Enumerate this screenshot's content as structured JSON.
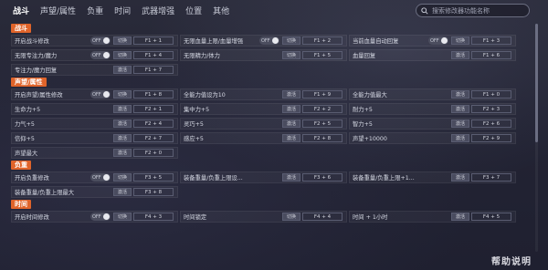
{
  "nav": {
    "tabs": [
      "战斗",
      "声望/属性",
      "负重",
      "时间",
      "武器增强",
      "位置",
      "其他"
    ],
    "active_index": 0
  },
  "search": {
    "placeholder": "搜索修改器功能名称"
  },
  "sections": [
    {
      "title": "战斗",
      "rows": [
        [
          {
            "label": "开启战斗修改",
            "type": "toggle",
            "toggle_text": "OFF",
            "action": "切换",
            "hotkey": "F1 + 1"
          },
          {
            "label": "无限血量上限/血量增强",
            "type": "toggle",
            "toggle_text": "OFF",
            "action": "切换",
            "hotkey": "F1 + 2"
          },
          {
            "label": "当前血量自动回复",
            "type": "toggle",
            "toggle_text": "OFF",
            "action": "切换",
            "hotkey": "F1 + 3"
          }
        ],
        [
          {
            "label": "无限专注力/魔力",
            "type": "toggle",
            "toggle_text": "OFF",
            "action": "切换",
            "hotkey": "F1 + 4"
          },
          {
            "label": "无限精力/体力",
            "type": "toggle",
            "toggle_text": "",
            "action": "切换",
            "hotkey": "F1 + 5"
          },
          {
            "label": "血量回复",
            "type": "button",
            "action": "激活",
            "hotkey": "F1 + 6"
          }
        ],
        [
          {
            "label": "专注力/魔力回复",
            "type": "button",
            "action": "激活",
            "hotkey": "F1 + 7"
          }
        ]
      ]
    },
    {
      "title": "声望/属性",
      "rows": [
        [
          {
            "label": "开启声望/属性修改",
            "type": "toggle",
            "toggle_text": "OFF",
            "action": "切换",
            "hotkey": "F1 + 8"
          },
          {
            "label": "全能力值设为10",
            "type": "button",
            "action": "激活",
            "hotkey": "F1 + 9"
          },
          {
            "label": "全能力值最大",
            "type": "button",
            "action": "激活",
            "hotkey": "F1 + 0"
          }
        ],
        [
          {
            "label": "生命力+5",
            "type": "button",
            "action": "激活",
            "hotkey": "F2 + 1"
          },
          {
            "label": "集中力+5",
            "type": "button",
            "action": "激活",
            "hotkey": "F2 + 2"
          },
          {
            "label": "耐力+5",
            "type": "button",
            "action": "激活",
            "hotkey": "F2 + 3"
          }
        ],
        [
          {
            "label": "力气+5",
            "type": "button",
            "action": "激活",
            "hotkey": "F2 + 4"
          },
          {
            "label": "灵巧+5",
            "type": "button",
            "action": "激活",
            "hotkey": "F2 + 5"
          },
          {
            "label": "智力+5",
            "type": "button",
            "action": "激活",
            "hotkey": "F2 + 6"
          }
        ],
        [
          {
            "label": "信仰+5",
            "type": "button",
            "action": "激活",
            "hotkey": "F2 + 7"
          },
          {
            "label": "感应+5",
            "type": "button",
            "action": "激活",
            "hotkey": "F2 + 8"
          },
          {
            "label": "声望+10000",
            "type": "button",
            "action": "激活",
            "hotkey": "F2 + 9"
          }
        ],
        [
          {
            "label": "声望最大",
            "type": "button",
            "action": "激活",
            "hotkey": "F2 + 0"
          }
        ]
      ]
    },
    {
      "title": "负重",
      "rows": [
        [
          {
            "label": "开启负重修改",
            "type": "toggle",
            "toggle_text": "OFF",
            "action": "切换",
            "hotkey": "F3 + 5"
          },
          {
            "label": "装备重量/负重上限设...",
            "type": "button",
            "action": "激活",
            "hotkey": "F3 + 6"
          },
          {
            "label": "装备重量/负重上限+1...",
            "type": "button",
            "action": "激活",
            "hotkey": "F3 + 7"
          }
        ],
        [
          {
            "label": "装备重量/负重上限最大",
            "type": "button",
            "action": "激活",
            "hotkey": "F3 + 8"
          }
        ]
      ]
    },
    {
      "title": "时间",
      "rows": [
        [
          {
            "label": "开启时间修改",
            "type": "toggle",
            "toggle_text": "OFF",
            "action": "切换",
            "hotkey": "F4 + 3"
          },
          {
            "label": "时间锁定",
            "type": "toggle",
            "toggle_text": "",
            "action": "切换",
            "hotkey": "F4 + 4"
          },
          {
            "label": "时间 + 1小时",
            "type": "button",
            "action": "激活",
            "hotkey": "F4 + 5"
          }
        ]
      ]
    }
  ],
  "watermark": {
    "text": "帮助说明"
  },
  "colors": {
    "accent": "#e0642a",
    "background": "#232434",
    "cell": "#2e2f3f",
    "button": "#4a4c5f"
  }
}
